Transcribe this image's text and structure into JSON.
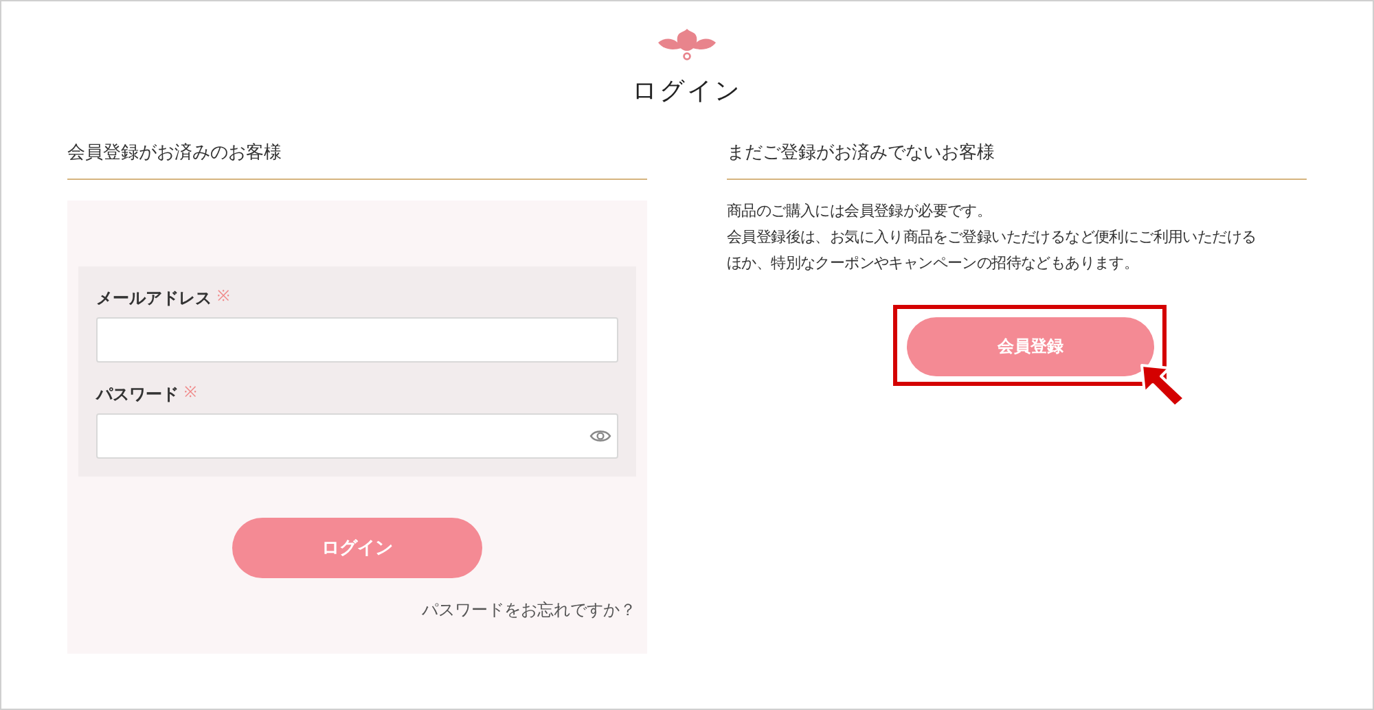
{
  "title": "ログイン",
  "member_section": {
    "heading": "会員登録がお済みのお客様",
    "fields": [
      {
        "label": "メールアドレス",
        "required_mark": "※",
        "kind": "text"
      },
      {
        "label": "パスワード",
        "required_mark": "※",
        "kind": "password"
      }
    ],
    "login_button": "ログイン",
    "forgot_link": "パスワードをお忘れですか？"
  },
  "guest_section": {
    "heading": "まだご登録がお済みでないお客様",
    "description": [
      "商品のご購入には会員登録が必要です。",
      "会員登録後は、お気に入り商品をご登録いただけるなど便利にご利用いただける",
      "ほか、特別なクーポンやキャンペーンの招待などもあります。"
    ],
    "register_button": {
      "label": "会員登録",
      "highlighted": true
    }
  }
}
